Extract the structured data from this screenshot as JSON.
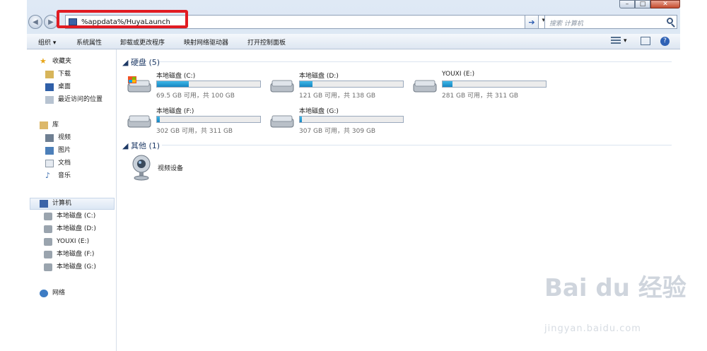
{
  "window": {
    "minimize_icon": "minimize-icon",
    "maximize_icon": "maximize-icon",
    "close_icon": "close-icon"
  },
  "nav_bar": {
    "address_value": "%appdata%/HuyaLaunch",
    "search_placeholder": "搜索 计算机",
    "highlight_color": "#e11b22"
  },
  "toolbar": {
    "organize": "组织 ▾",
    "system_properties": "系统属性",
    "uninstall": "卸载或更改程序",
    "map_drive": "映射网络驱动器",
    "control_panel": "打开控制面板"
  },
  "sidebar": {
    "favorites": "收藏夹",
    "downloads": "下载",
    "desktop": "桌面",
    "recent": "最近访问的位置",
    "libraries": "库",
    "videos": "视频",
    "pictures": "图片",
    "documents": "文档",
    "music": "音乐",
    "computer": "计算机",
    "drives": [
      "本地磁盘 (C:)",
      "本地磁盘 (D:)",
      "YOUXI  (E:)",
      "本地磁盘 (F:)",
      "本地磁盘 (G:)"
    ],
    "network": "网络"
  },
  "main": {
    "hard_disks_header": "硬盘 (5)",
    "other_header": "其他 (1)",
    "drives": [
      {
        "name": "本地磁盘 (C:)",
        "free": "69.5 GB 可用，共 100 GB",
        "used_fraction": 0.305
      },
      {
        "name": "本地磁盘 (D:)",
        "free": "121 GB 可用，共 138 GB",
        "used_fraction": 0.123
      },
      {
        "name": "YOUXI  (E:)",
        "free": "281 GB 可用，共 311 GB",
        "used_fraction": 0.096
      },
      {
        "name": "本地磁盘 (F:)",
        "free": "302 GB 可用，共 311 GB",
        "used_fraction": 0.029
      },
      {
        "name": "本地磁盘 (G:)",
        "free": "307 GB 可用，共 309 GB",
        "used_fraction": 0.006
      }
    ],
    "device_label": "视频设备"
  },
  "watermark": {
    "logo": "Bai du 经验",
    "url": "jingyan.baidu.com"
  }
}
